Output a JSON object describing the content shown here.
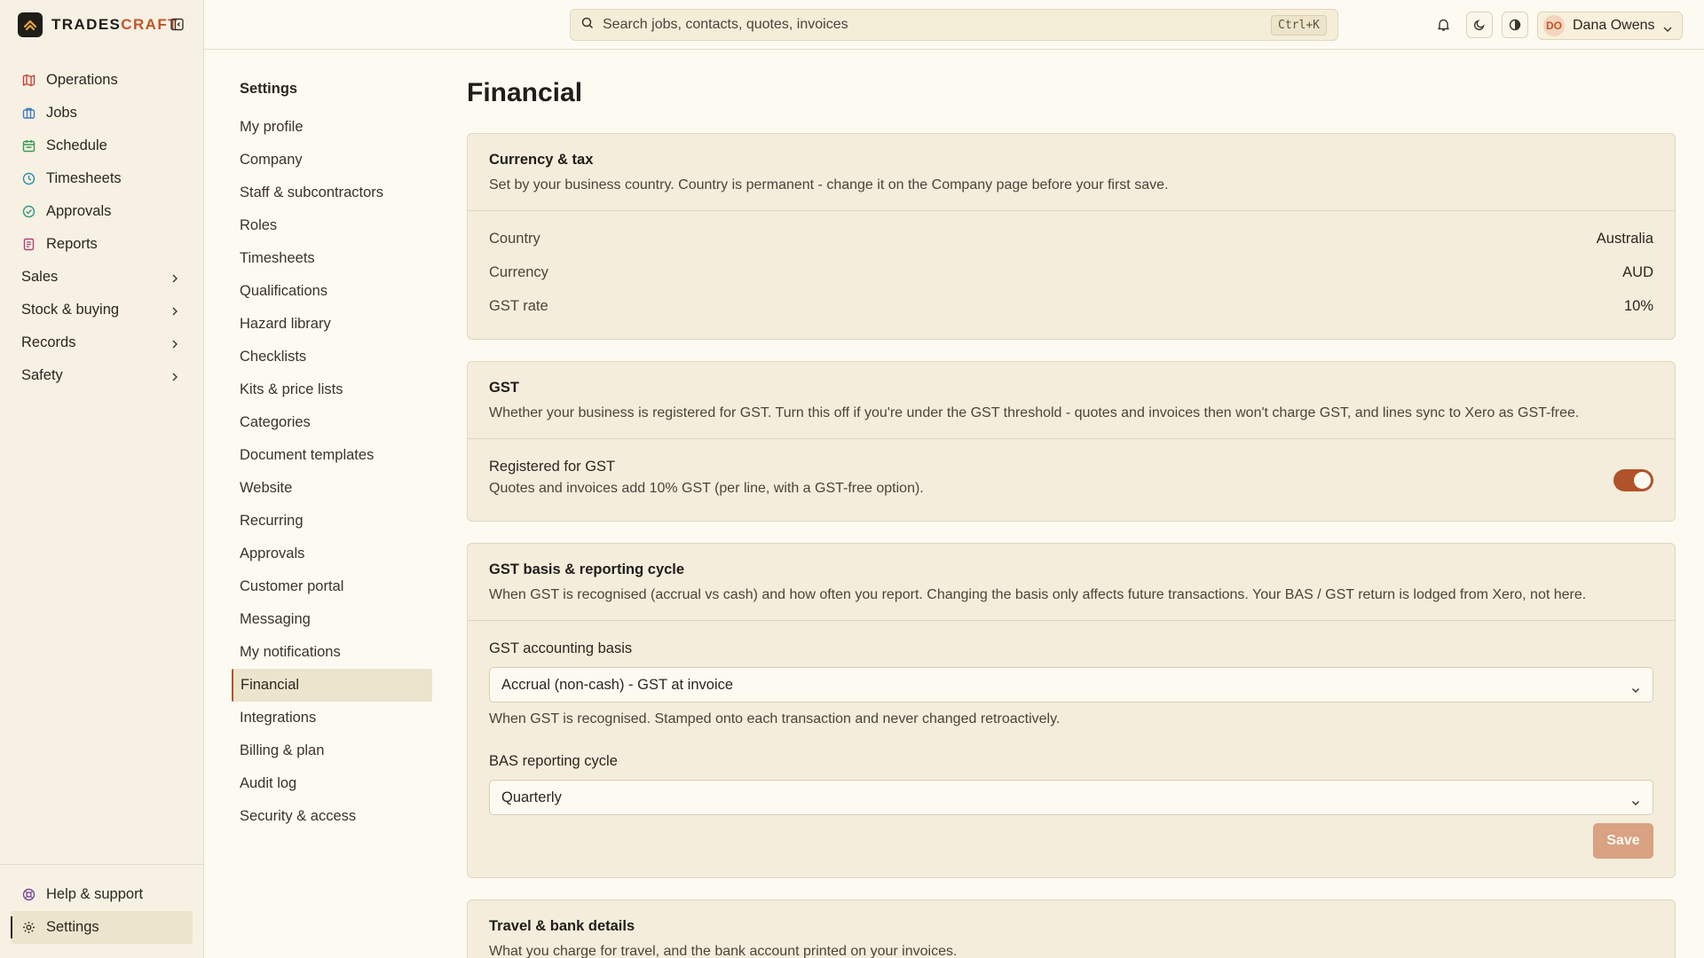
{
  "brand": {
    "name_main": "TRADES",
    "name_accent": "CRAFT"
  },
  "nav": {
    "items": [
      {
        "label": "Operations",
        "icon": "map-icon",
        "color": "#c8433a"
      },
      {
        "label": "Jobs",
        "icon": "briefcase-icon",
        "color": "#3f7fc0"
      },
      {
        "label": "Schedule",
        "icon": "calendar-icon",
        "color": "#3a9a55"
      },
      {
        "label": "Timesheets",
        "icon": "clock-icon",
        "color": "#2f8fa8"
      },
      {
        "label": "Approvals",
        "icon": "check-circle-icon",
        "color": "#2e9a7a"
      },
      {
        "label": "Reports",
        "icon": "report-icon",
        "color": "#b0427a"
      }
    ],
    "groups": [
      {
        "label": "Sales"
      },
      {
        "label": "Stock & buying"
      },
      {
        "label": "Records"
      },
      {
        "label": "Safety"
      }
    ],
    "help_label": "Help & support",
    "settings_label": "Settings"
  },
  "search": {
    "placeholder": "Search jobs, contacts, quotes, invoices",
    "shortcut": "Ctrl+K"
  },
  "user": {
    "initials": "DO",
    "name": "Dana Owens"
  },
  "subnav": {
    "title": "Settings",
    "items": [
      "My profile",
      "Company",
      "Staff & subcontractors",
      "Roles",
      "Timesheets",
      "Qualifications",
      "Hazard library",
      "Checklists",
      "Kits & price lists",
      "Categories",
      "Document templates",
      "Website",
      "Recurring",
      "Approvals",
      "Customer portal",
      "Messaging",
      "My notifications",
      "Financial",
      "Integrations",
      "Billing & plan",
      "Audit log",
      "Security & access"
    ],
    "active": "Financial"
  },
  "page": {
    "title": "Financial"
  },
  "currency_card": {
    "title": "Currency & tax",
    "desc": "Set by your business country. Country is permanent - change it on the Company page before your first save.",
    "rows": [
      {
        "label": "Country",
        "value": "Australia"
      },
      {
        "label": "Currency",
        "value": "AUD"
      },
      {
        "label": "GST rate",
        "value": "10%"
      }
    ]
  },
  "gst_card": {
    "title": "GST",
    "desc": "Whether your business is registered for GST. Turn this off if you're under the GST threshold - quotes and invoices then won't charge GST, and lines sync to Xero as GST-free.",
    "toggle_label": "Registered for GST",
    "toggle_sub": "Quotes and invoices add 10% GST (per line, with a GST-free option).",
    "toggle_on": true
  },
  "basis_card": {
    "title": "GST basis & reporting cycle",
    "desc": "When GST is recognised (accrual vs cash) and how often you report. Changing the basis only affects future transactions. Your BAS / GST return is lodged from Xero, not here.",
    "basis_label": "GST accounting basis",
    "basis_value": "Accrual (non-cash) - GST at invoice",
    "basis_help": "When GST is recognised. Stamped onto each transaction and never changed retroactively.",
    "cycle_label": "BAS reporting cycle",
    "cycle_value": "Quarterly",
    "save_label": "Save"
  },
  "travel_card": {
    "title": "Travel & bank details",
    "desc": "What you charge for travel, and the bank account printed on your invoices."
  },
  "colors": {
    "accent": "#b0532a",
    "background": "#fdfaf2",
    "card": "#f4eddb"
  }
}
